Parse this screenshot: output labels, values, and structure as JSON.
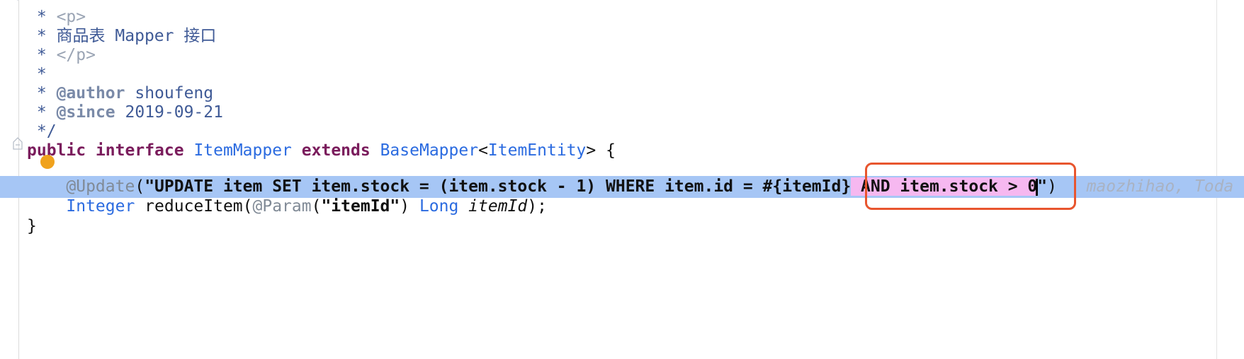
{
  "editor": {
    "comment_lines": [
      "* ",
      "* 商品表 Mapper 接口",
      "* ",
      "*",
      "* ",
      "* ",
      "*/"
    ],
    "comment_tags": {
      "p_open": "<p>",
      "p_close": "</p>",
      "author_tag": "@author",
      "author_value": " shoufeng",
      "since_tag": "@since",
      "since_value": " 2019-09-21"
    },
    "decl": {
      "pub": "pu",
      "blic": "blic",
      "interface": "interface",
      "name": "ItemMapper",
      "extends": "extends",
      "base": "BaseMapper",
      "lt": "<",
      "entity": "ItemEntity",
      "gt_brace": "> {"
    },
    "update_line": {
      "annotation": "@Update",
      "open": "(",
      "sql_a": "\"UPDATE item SET item.stock = (item.stock - 1) WHERE item.id = #{itemId}",
      "sql_b": " AND item.stock > 0",
      "sql_c": "\"",
      "close": ")",
      "blame": "maozhihao, Toda"
    },
    "method_line": {
      "ret_type": "Integer",
      "name": " reduceItem(",
      "param_anno": "@Param",
      "param_open": "(",
      "param_str": "\"itemId\"",
      "param_close": ") ",
      "param_type": "Long",
      "param_name": " itemId",
      "end": ");"
    },
    "closing_brace": "}"
  }
}
